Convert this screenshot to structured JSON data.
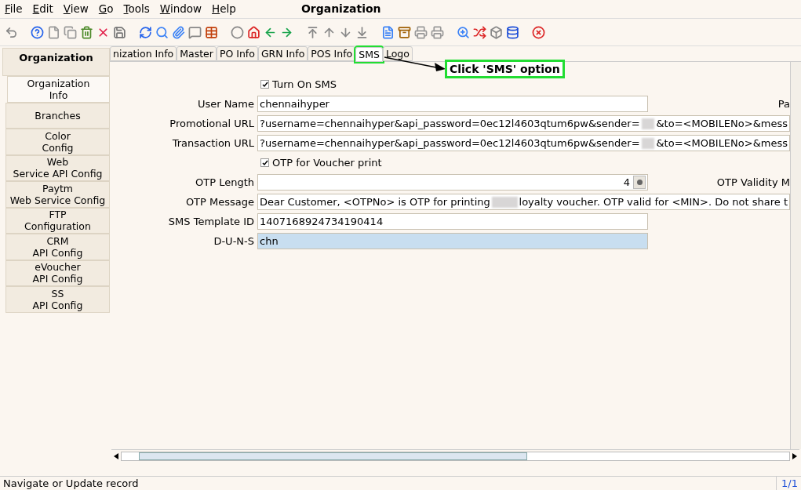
{
  "menu": [
    "File",
    "Edit",
    "View",
    "Go",
    "Tools",
    "Window",
    "Help"
  ],
  "window": {
    "title": "Organization"
  },
  "sidebar": {
    "header": "Organization",
    "items": [
      {
        "label": "Organization\nInfo",
        "selected": true
      },
      {
        "label": "Branches",
        "selected": false
      },
      {
        "label": "Color\nConfig",
        "selected": false
      },
      {
        "label": "Web\nService API Config",
        "selected": false
      },
      {
        "label": "Paytm\nWeb Service Config",
        "selected": false
      },
      {
        "label": "FTP\nConfiguration",
        "selected": false
      },
      {
        "label": "CRM\nAPI Config",
        "selected": false
      },
      {
        "label": "eVoucher\nAPI Config",
        "selected": false
      },
      {
        "label": "SS\nAPI Config",
        "selected": false
      }
    ]
  },
  "tabs": [
    {
      "label": "nization Info",
      "selected": false
    },
    {
      "label": "Master",
      "selected": false
    },
    {
      "label": "PO Info",
      "selected": false
    },
    {
      "label": "GRN Info",
      "selected": false
    },
    {
      "label": "POS Info",
      "selected": false
    },
    {
      "label": "SMS",
      "selected": true
    },
    {
      "label": "Logo",
      "selected": false
    }
  ],
  "annotation": {
    "text": "Click 'SMS' option"
  },
  "form": [
    {
      "kind": "checkbox",
      "label": "Turn On SMS",
      "checked": true
    },
    {
      "kind": "text",
      "label": "User Name",
      "parts": [
        {
          "kind": "text",
          "text": "chennaihyper"
        }
      ],
      "side_label": "Pa"
    },
    {
      "kind": "wide",
      "label": "Promotional URL",
      "parts": [
        {
          "kind": "text",
          "text": "?username=chennaihyper&api_password=0ec12l4603qtum6pw&sender="
        },
        {
          "kind": "redacted"
        },
        {
          "kind": "text",
          "text": "&to=<MOBILENo>&mess"
        }
      ]
    },
    {
      "kind": "wide",
      "label": "Transaction URL",
      "parts": [
        {
          "kind": "text",
          "text": "?username=chennaihyper&api_password=0ec12l4603qtum6pw&sender="
        },
        {
          "kind": "redacted"
        },
        {
          "kind": "text",
          "text": "&to=<MOBILENo>&mess"
        }
      ]
    },
    {
      "kind": "checkbox",
      "label": "OTP for Voucher print",
      "checked": true
    },
    {
      "kind": "number",
      "label": "OTP Length",
      "parts": [
        {
          "kind": "text",
          "text": "4"
        }
      ],
      "side_label": "OTP Validity M"
    },
    {
      "kind": "wide",
      "label": "OTP Message",
      "parts": [
        {
          "kind": "text",
          "text": "Dear Customer, <OTPNo> is OTP for printing"
        },
        {
          "kind": "redacted"
        },
        {
          "kind": "text",
          "text": "loyalty voucher. OTP valid for <MIN>. Do not share t"
        }
      ]
    },
    {
      "kind": "text",
      "label": "SMS Template ID",
      "parts": [
        {
          "kind": "text",
          "text": "1407168924734190414"
        }
      ]
    },
    {
      "kind": "focused",
      "label": "D-U-N-S",
      "parts": [
        {
          "kind": "text",
          "text": "chn"
        }
      ]
    }
  ],
  "status_bar": {
    "message": "Navigate or Update record",
    "record": "1/1"
  }
}
